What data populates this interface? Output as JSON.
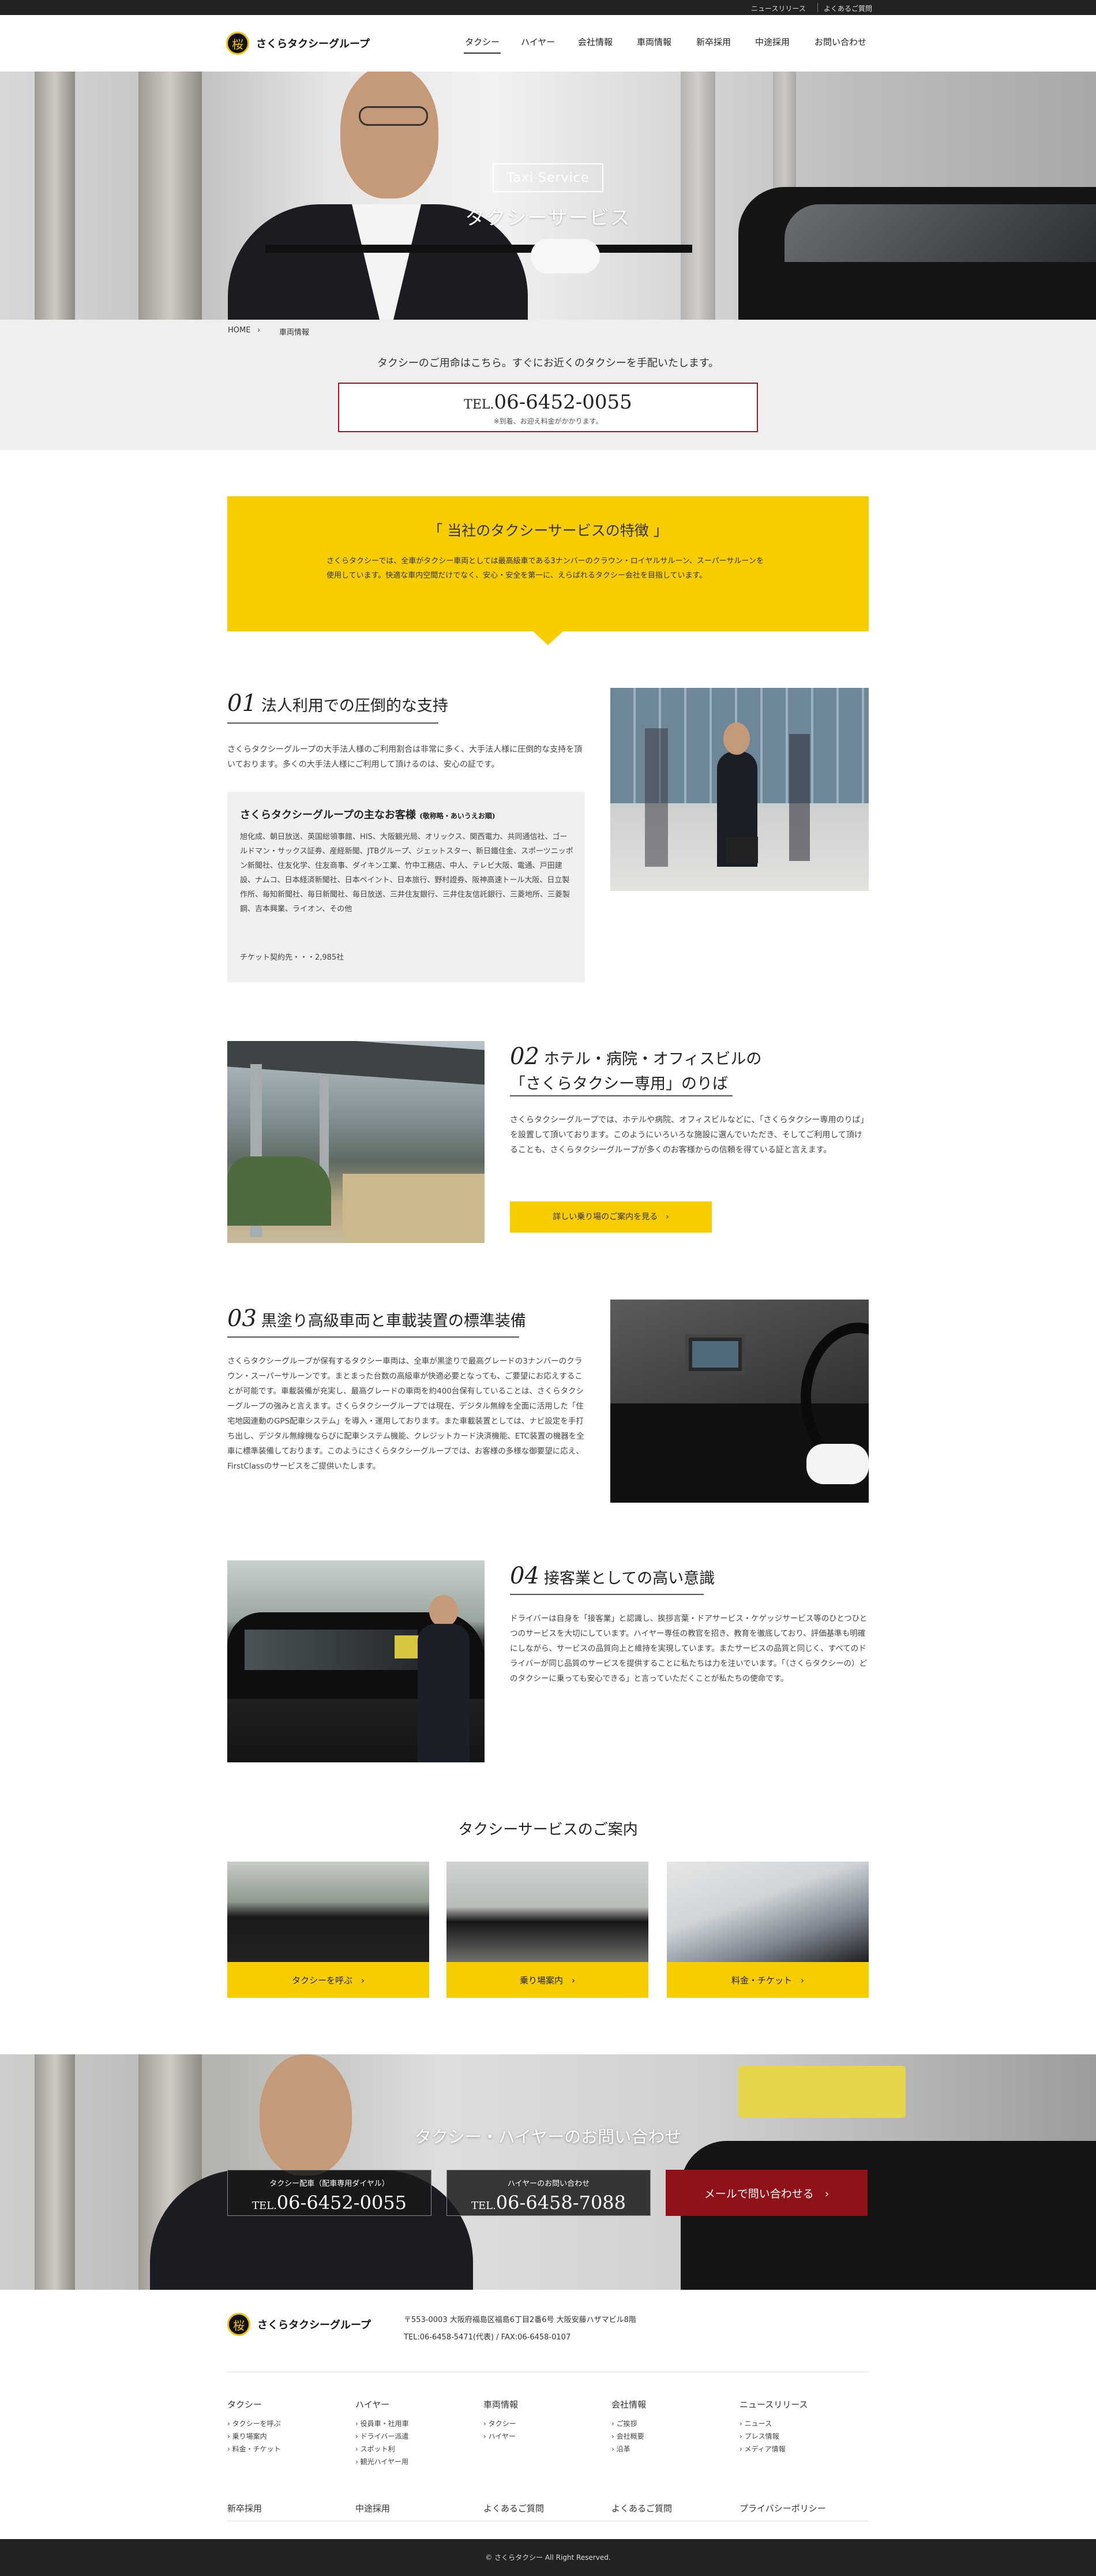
{
  "utility": {
    "news": "ニュースリリース",
    "faq": "よくあるご質問"
  },
  "brand": {
    "name": "さくらタクシーグループ",
    "mark": "桜"
  },
  "nav": [
    "タクシー",
    "ハイヤー",
    "会社情報",
    "車両情報",
    "新卒採用",
    "中途採用",
    "お問い合わせ"
  ],
  "hero": {
    "en": "Taxi Service",
    "ja": "タクシーサービス"
  },
  "breadcrumb": [
    "HOME",
    "車両情報"
  ],
  "tel_section": {
    "intro": "タクシーのご用命はこちら。すぐにお近くのタクシーを手配いたします。",
    "prefix": "TEL.",
    "number": "06-6452-0055",
    "note": "※到着、お迎え料金がかかります。"
  },
  "feature": {
    "title": "「 当社のタクシーサービスの特徴 」",
    "text": "さくらタクシーでは、全車がタクシー車両としては最高級車である3ナンバーのクラウン・ロイヤルサルーン、スーパーサルーンを使用しています。快適な車内空間だけでなく、安心・安全を第一に、えらばれるタクシー会社を目指しています。"
  },
  "sec1": {
    "num": "01",
    "title": "法人利用での圧倒的な支持",
    "text": "さくらタクシーグループの大手法人様のご利用割合は非常に多く、大手法人様に圧倒的な支持を頂いております。多くの大手法人様にご利用して頂けるのは、安心の証です。",
    "box_title": "さくらタクシーグループの主なお客様",
    "box_sub": "(敬称略・あいうえお順)",
    "box_text": "旭化成、朝日放送、英国総領事館、HIS、大阪観光局、オリックス、関西電力、共同通信社、ゴールドマン・サックス証券、産経新聞、JTBグループ、ジェットスター、新日鐵住金、スポーツニッポン新聞社、住友化学、住友商事、ダイキン工業、竹中工務店、中人、テレビ大阪、電通、戸田建設、ナムコ、日本経済新聞社、日本ペイント、日本旅行、野村證券、阪神高速トール大阪、日立製作所、毎知新聞社、毎日新聞社、毎日放送、三井住友銀行、三井住友信託銀行、三菱地所、三菱製鋼、吉本興業、ライオン、その他",
    "box_count": "チケット契約先・・・2,985社"
  },
  "sec2": {
    "num": "02",
    "title1": "ホテル・病院・オフィスビルの",
    "title2": "「さくらタクシー専用」のりば",
    "text": "さくらタクシーグループでは、ホテルや病院、オフィスビルなどに、「さくらタクシー専用のりば」を設置して頂いております。このようにいろいろな施設に選んでいただき、そしてご利用して頂けることも、さくらタクシーグループが多くのお客様からの信頼を得ている証と言えます。",
    "button": "詳しい乗り場のご案内を見る　›"
  },
  "sec3": {
    "num": "03",
    "title": "黒塗り高級車両と車載装置の標準装備",
    "text": "さくらタクシーグループが保有するタクシー車両は、全車が黒塗りで最高グレードの3ナンバーのクラウン・スーパーサルーンです。まとまった台数の高級車が快適必要となっても、ご要望にお応えすることが可能です。車載装備が充実し、最高グレードの車両を約400台保有していることは、さくらタクシーグループの強みと言えます。さくらタクシーグループでは現在、デジタル無線を全面に活用した「住宅地図連動のGPS配車システム」を導入・運用しております。また車載装置としては、ナビ設定を手打ち出し、デジタル無線機ならびに配車システム機能、クレジットカード決済機能、ETC装置の機器を全車に標準装備しております。このようにさくらタクシーグループでは、お客様の多様な御要望に応え、FirstClassのサービスをご提供いたします。"
  },
  "sec4": {
    "num": "04",
    "title": "接客業としての高い意識",
    "text": "ドライバーは自身を「接客業」と認識し、挨拶言葉・ドアサービス・ケゲッジサービス等のひとつひとつのサービスを大切にしています。ハイヤー専任の教官を招き、教育を徹底しており、評価基準も明確にしながら、サービスの品質向上と維持を実現しています。またサービスの品質と同じく、すべてのドライバーが同じ品質のサービスを提供することに私たちは力を注いでいます。「（さくらタクシーの）どのタクシーに乗っても安心できる」と言っていただくことが私たちの使命です。"
  },
  "service_nav": {
    "title": "タクシーサービスのご案内",
    "cards": [
      "タクシーを呼ぶ　›",
      "乗り場案内　›",
      "料金・チケット　›"
    ]
  },
  "contact": {
    "title": "タクシー・ハイヤーのお問い合わせ",
    "taxi_label": "タクシー配車（配車専用ダイヤル）",
    "taxi_prefix": "TEL.",
    "taxi_number": "06-6452-0055",
    "hire_label": "ハイヤーのお問い合わせ",
    "hire_prefix": "TEL.",
    "hire_number": "06-6458-7088",
    "mail": "メールで問い合わせる　›"
  },
  "footer": {
    "address": "〒553-0003 大阪府福島区福島6丁目2番6号 大阪安藤ハザマビル8階",
    "tel": "TEL:06-6458-5471(代表)  / FAX:06-6458-0107",
    "columns": [
      {
        "head": "タクシー",
        "items": [
          "› タクシーを呼ぶ",
          "› 乗り場案内",
          "› 料金・チケット"
        ]
      },
      {
        "head": "ハイヤー",
        "items": [
          "› 役員車・社用車",
          "› ドライバー派遣",
          "› スポット利",
          "› 観光ハイヤー用"
        ]
      },
      {
        "head": "車両情報",
        "items": [
          "› タクシー",
          "› ハイヤー"
        ]
      },
      {
        "head": "会社情報",
        "items": [
          "› ご挨拶",
          "› 会社概要",
          "› 沿革"
        ]
      },
      {
        "head": "ニュースリリース",
        "items": [
          "› ニュース",
          "› プレス情報",
          "› メディア情報"
        ]
      }
    ],
    "bottom_links": [
      "新卒採用",
      "中途採用",
      "よくあるご質問",
      "よくあるご質問",
      "プライバシーポリシー"
    ],
    "copyright": "© さくらタクシー All Right Reserved."
  },
  "colors": {
    "accent": "#f8cd00",
    "dark": "#222222",
    "red": "#8e1218"
  }
}
